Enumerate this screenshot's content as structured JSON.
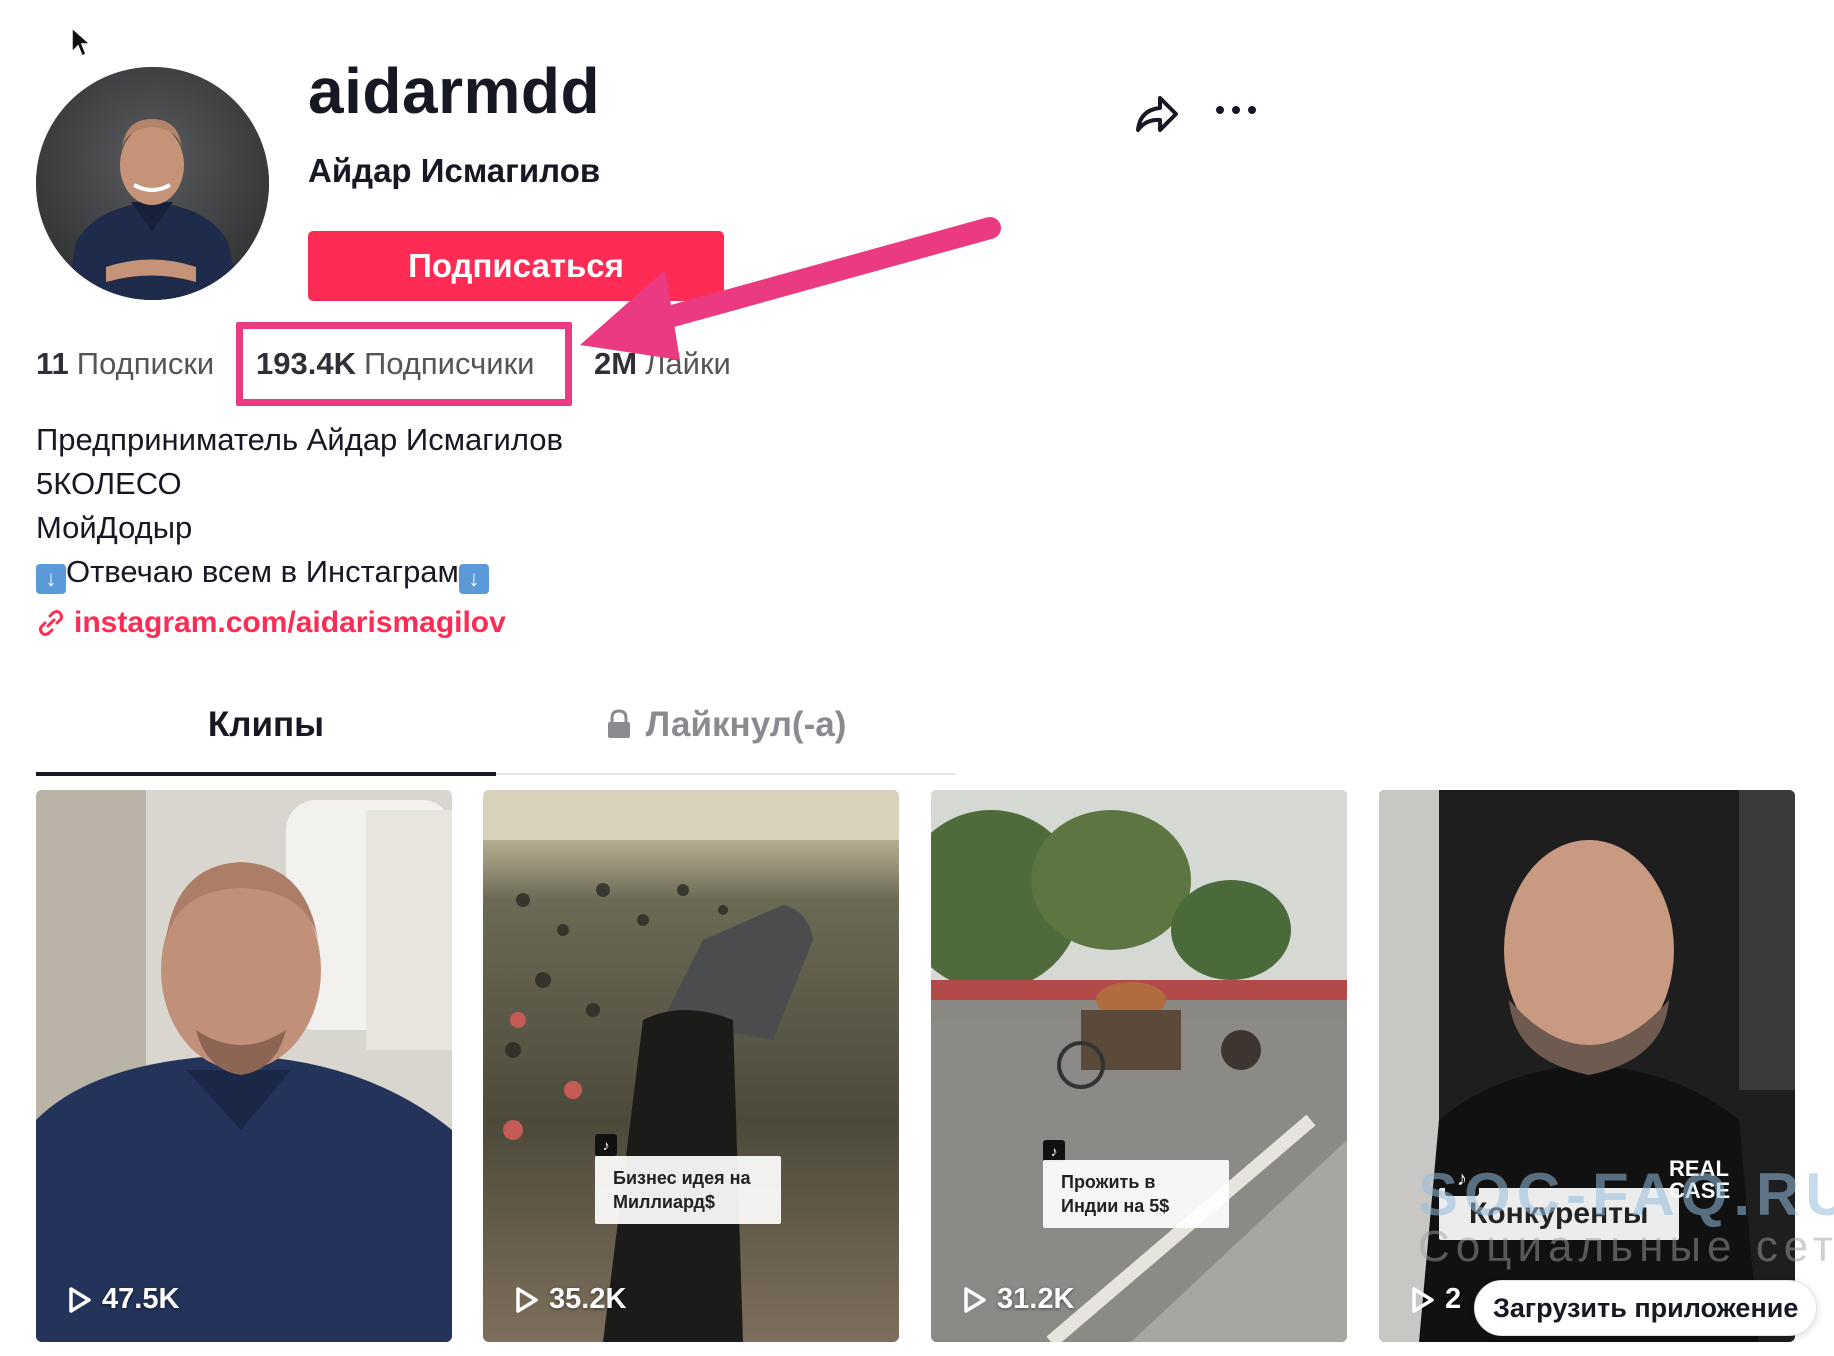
{
  "profile": {
    "username": "aidarmdd",
    "full_name": "Айдар Исмагилов",
    "follow_label": "Подписаться"
  },
  "stats": {
    "following_count": "11",
    "following_label": "Подписки",
    "followers_count": "193.4K",
    "followers_label": "Подписчики",
    "likes_count": "2M",
    "likes_label": "Лайки"
  },
  "bio": {
    "line1": "Предприниматель Айдар Исмагилов",
    "line2": "5КОЛЕСО",
    "line3": "МойДодыр",
    "line4": "Отвечаю всем в Инстаграм",
    "link": "instagram.com/aidarismagilov"
  },
  "tabs": {
    "videos": "Клипы",
    "liked": "Лайкнул(-а)"
  },
  "videos": [
    {
      "views": "47.5K",
      "caption": ""
    },
    {
      "views": "35.2K",
      "caption": "Бизнес идея на Миллиард$"
    },
    {
      "views": "31.2K",
      "caption": "Прожить в Индии на 5$"
    },
    {
      "views": "2",
      "caption": "Конкуренты"
    }
  ],
  "video4_logo": "REAL CASE",
  "watermark": {
    "line1": "SOC-FAQ.RU",
    "line2": "Социальные сети"
  },
  "get_app_label": "Загрузить приложение",
  "colors": {
    "accent": "#fe2c55",
    "highlight": "#ea3a82"
  },
  "icons": [
    "cursor-icon",
    "share-icon",
    "more-icon",
    "link-icon",
    "lock-icon",
    "play-icon",
    "tiktok-icon"
  ]
}
